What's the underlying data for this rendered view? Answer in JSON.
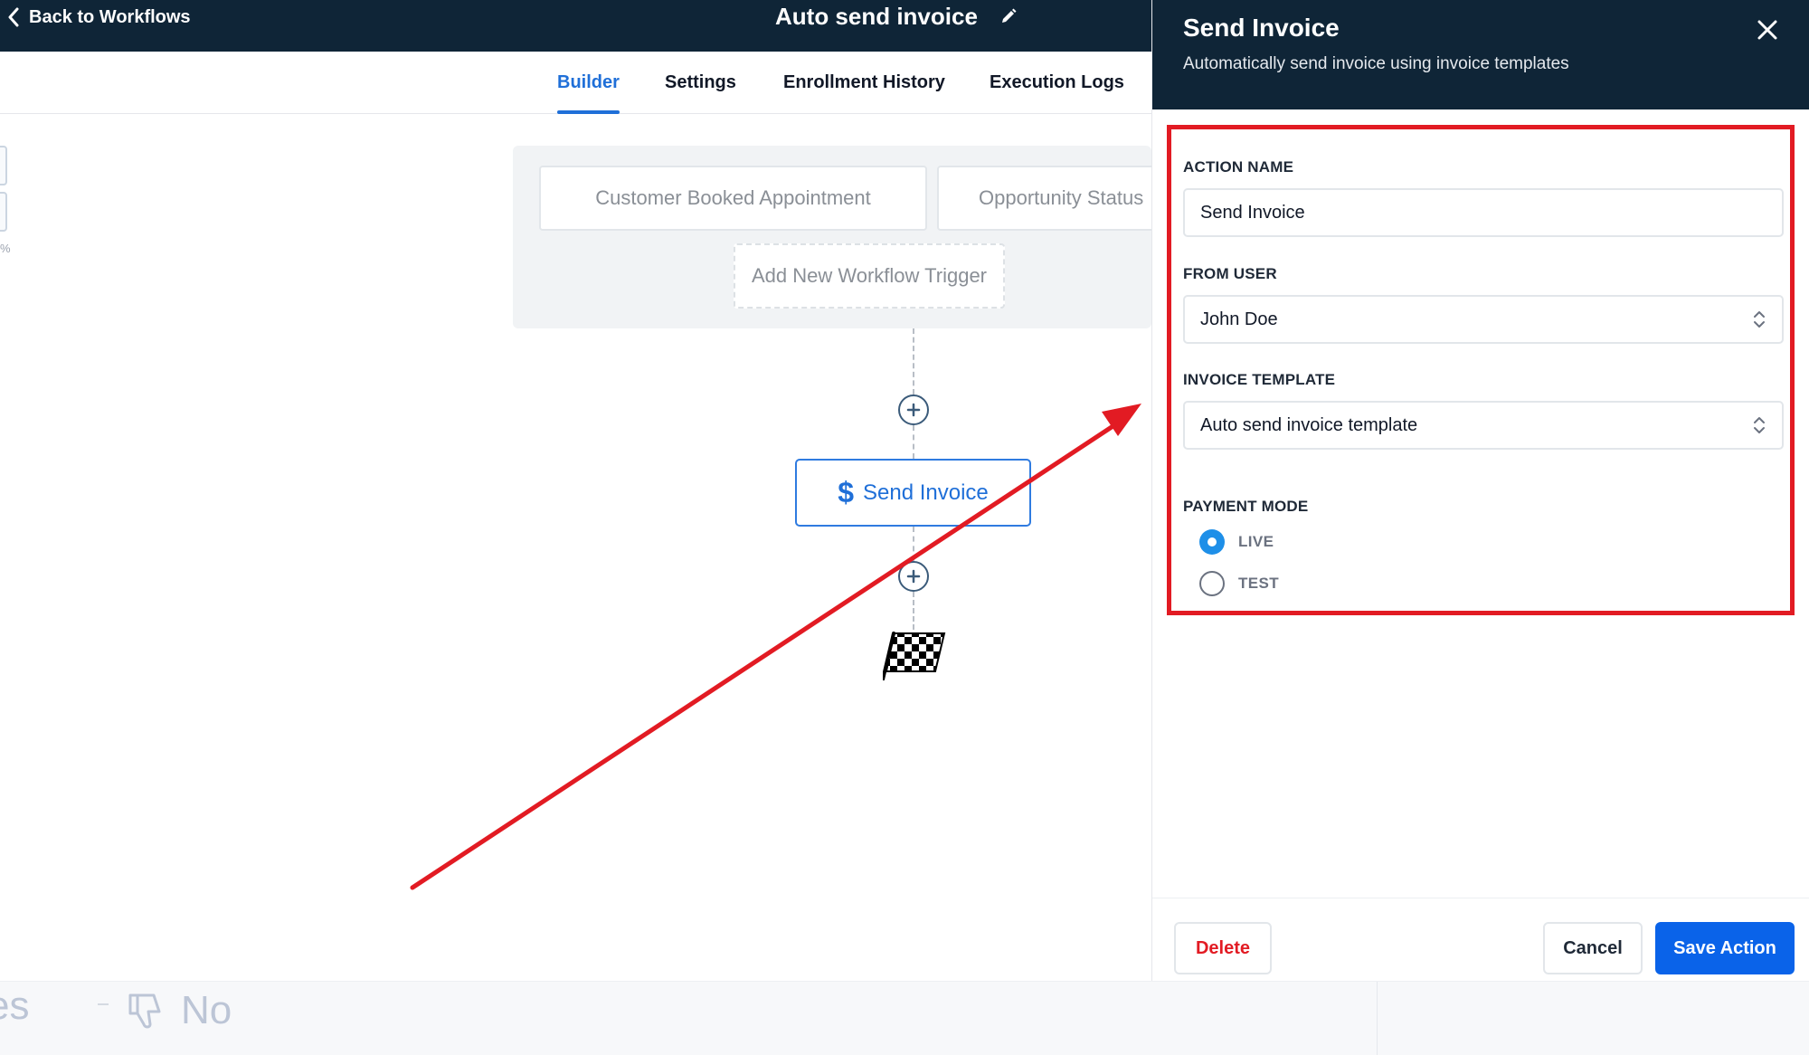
{
  "topbar": {
    "back_label": "Back to Workflows",
    "workflow_title": "Auto send invoice"
  },
  "tabs": [
    {
      "label": "Builder",
      "active": true
    },
    {
      "label": "Settings",
      "active": false
    },
    {
      "label": "Enrollment History",
      "active": false
    },
    {
      "label": "Execution Logs",
      "active": false
    }
  ],
  "canvas": {
    "edge_percent_fragment": "%",
    "triggers": [
      "Customer Booked Appointment",
      "Opportunity Status"
    ],
    "add_trigger_label": "Add New Workflow Trigger",
    "action_node_label": "Send Invoice",
    "action_icon": "dollar-icon",
    "end_icon": "checkered-flag-icon"
  },
  "panel": {
    "title": "Send Invoice",
    "subtitle": "Automatically send invoice using invoice templates",
    "action_name": {
      "label": "ACTION NAME",
      "value": "Send Invoice"
    },
    "from_user": {
      "label": "FROM USER",
      "value": "John Doe"
    },
    "invoice_template": {
      "label": "INVOICE TEMPLATE",
      "value": "Auto send invoice template"
    },
    "payment_mode": {
      "label": "PAYMENT MODE",
      "options": [
        {
          "label": "LIVE",
          "checked": true
        },
        {
          "label": "TEST",
          "checked": false
        }
      ]
    },
    "buttons": {
      "delete": "Delete",
      "cancel": "Cancel",
      "save": "Save Action"
    }
  },
  "feedback": {
    "yes_fragment": "es",
    "no_label": "No"
  },
  "colors": {
    "header_navy": "#0f2537",
    "accent_blue": "#1f6fd8",
    "save_blue": "#0a63e9",
    "radio_blue": "#1e8fe8",
    "annotation_red": "#e21b23"
  }
}
